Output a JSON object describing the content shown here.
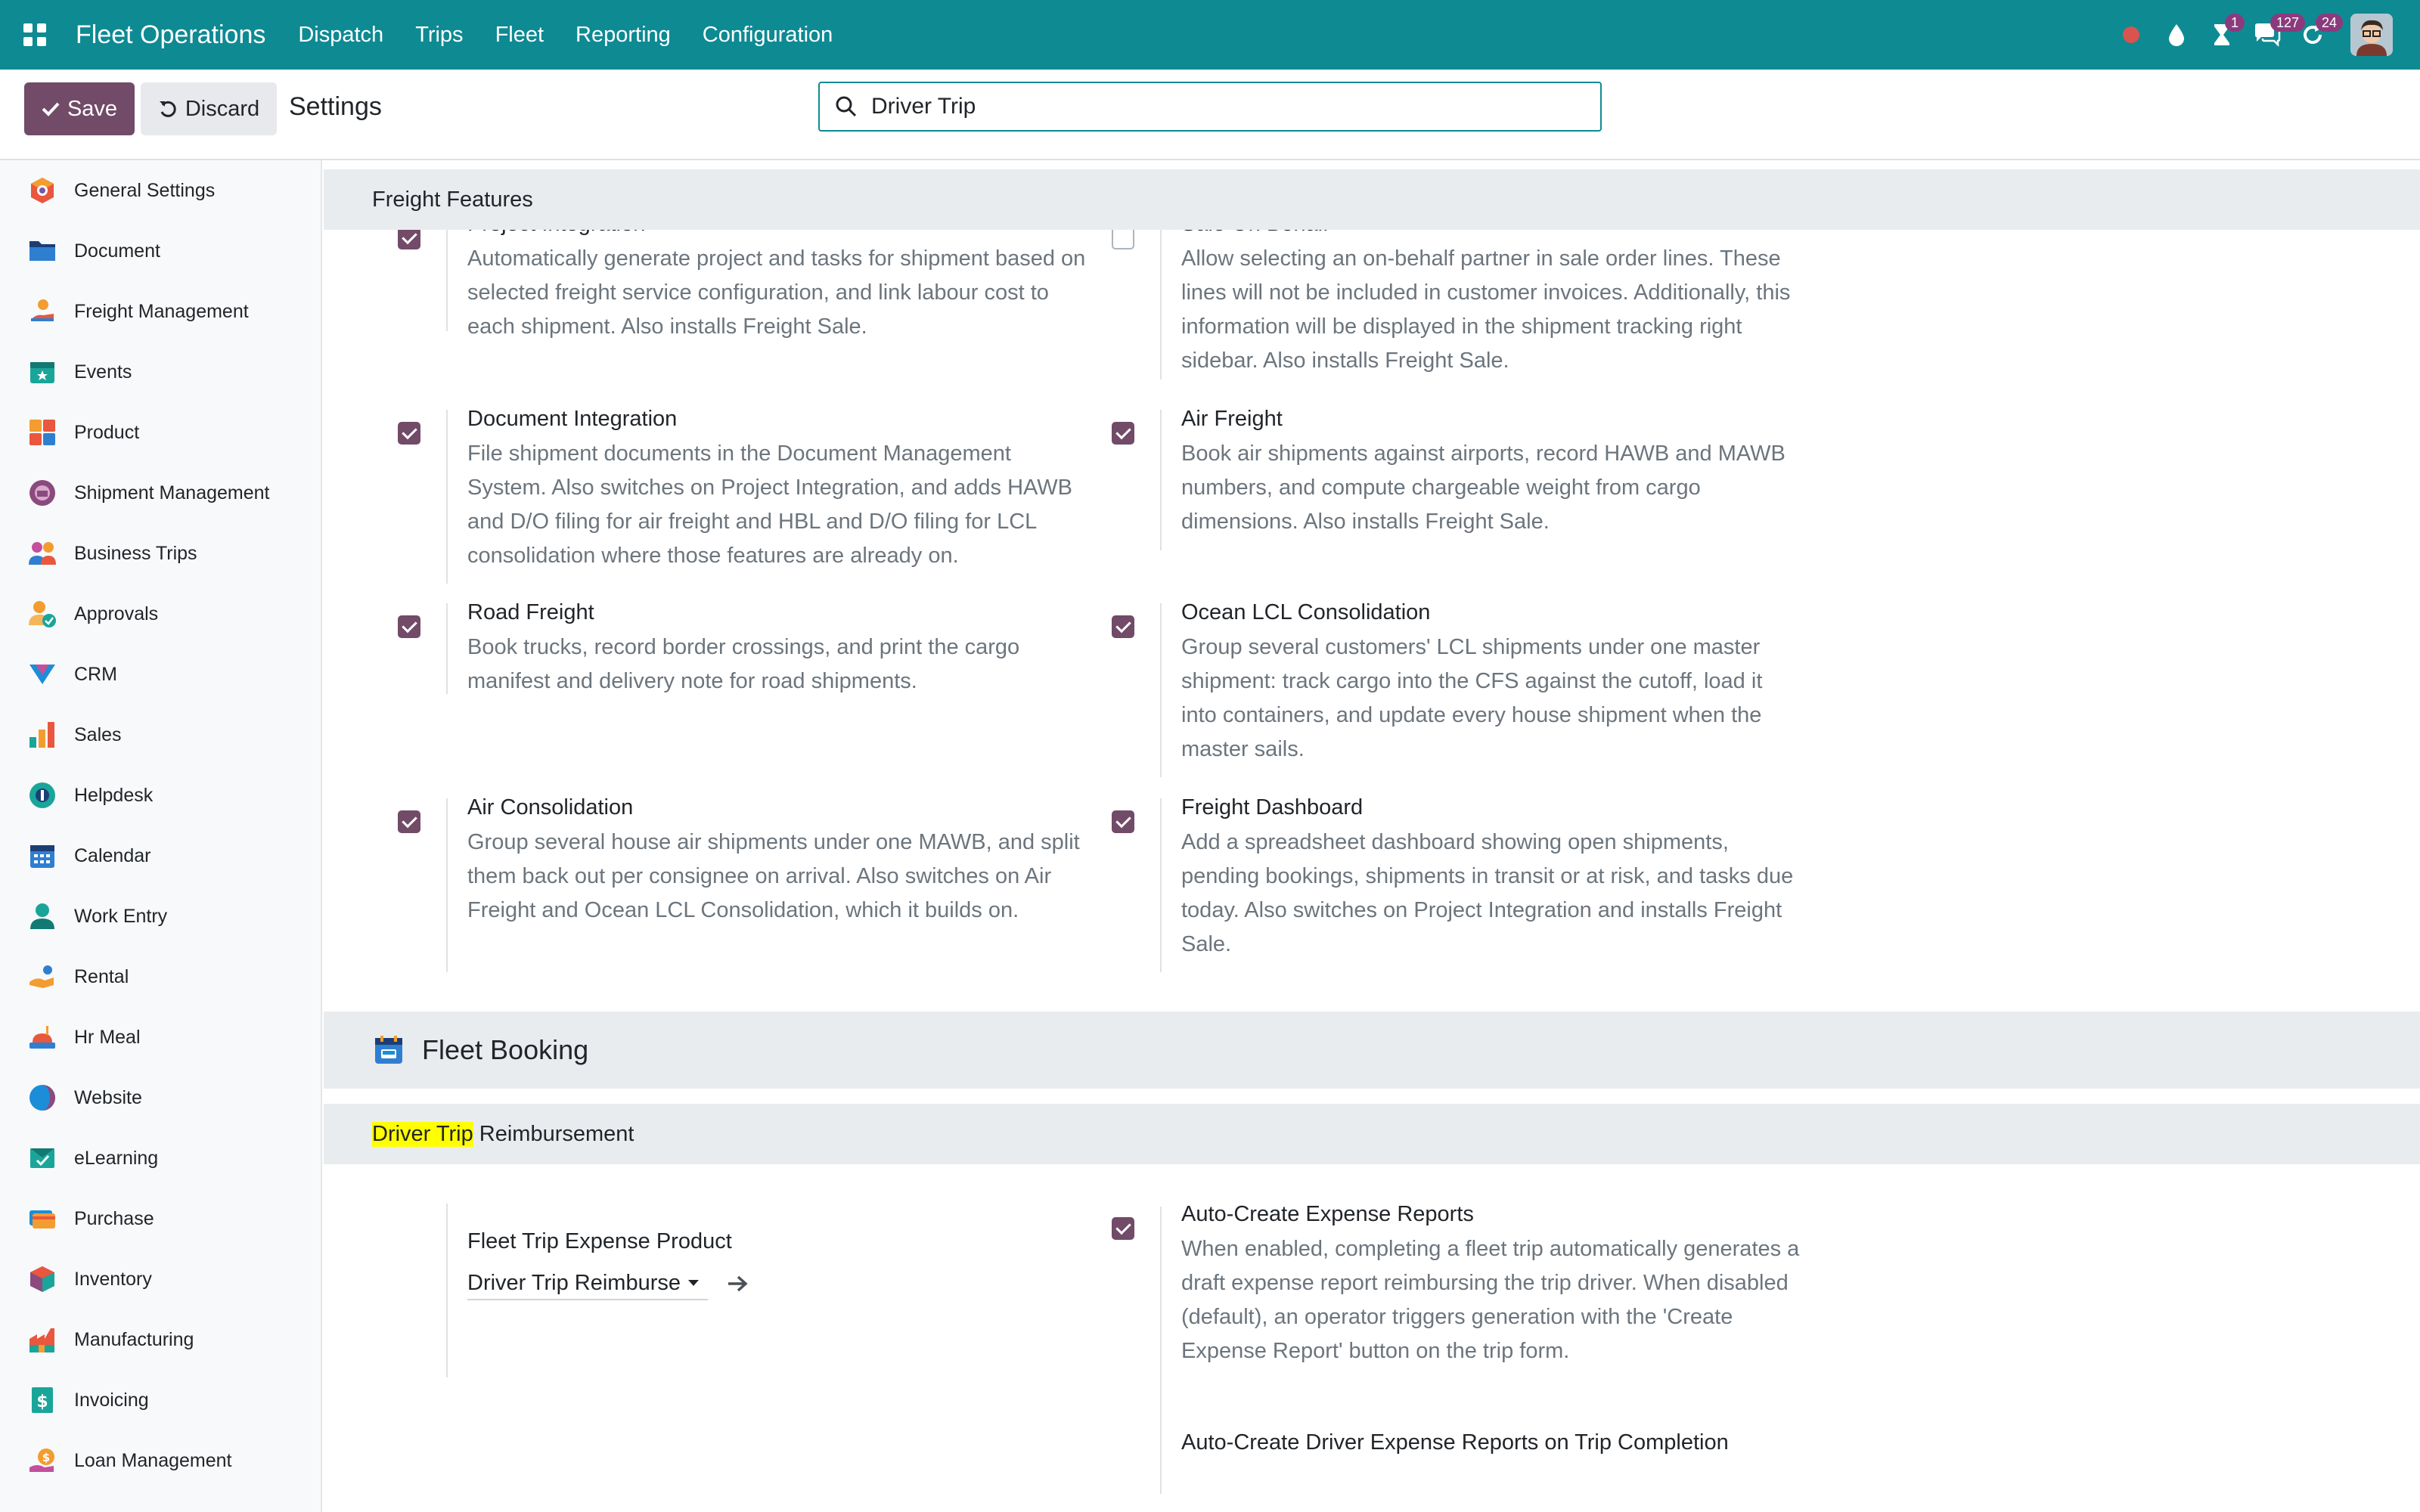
{
  "navbar": {
    "brand": "Fleet Operations",
    "menu": [
      "Dispatch",
      "Trips",
      "Fleet",
      "Reporting",
      "Configuration"
    ],
    "badges": {
      "activities": "1",
      "messages": "127",
      "updates": "24"
    }
  },
  "control": {
    "save_label": "Save",
    "discard_label": "Discard",
    "breadcrumb": "Settings",
    "search_value": "Driver Trip"
  },
  "sidebar": {
    "items": [
      {
        "label": "General Settings",
        "icon": "general-settings-icon"
      },
      {
        "label": "Document",
        "icon": "folder-icon"
      },
      {
        "label": "Freight Management",
        "icon": "freight-icon"
      },
      {
        "label": "Events",
        "icon": "events-icon"
      },
      {
        "label": "Product",
        "icon": "product-icon"
      },
      {
        "label": "Shipment Management",
        "icon": "shipment-icon"
      },
      {
        "label": "Business Trips",
        "icon": "business-trips-icon"
      },
      {
        "label": "Approvals",
        "icon": "approvals-icon"
      },
      {
        "label": "CRM",
        "icon": "crm-icon"
      },
      {
        "label": "Sales",
        "icon": "sales-icon"
      },
      {
        "label": "Helpdesk",
        "icon": "helpdesk-icon"
      },
      {
        "label": "Calendar",
        "icon": "calendar-icon"
      },
      {
        "label": "Work Entry",
        "icon": "work-entry-icon"
      },
      {
        "label": "Rental",
        "icon": "rental-icon"
      },
      {
        "label": "Hr Meal",
        "icon": "hr-meal-icon"
      },
      {
        "label": "Website",
        "icon": "website-icon"
      },
      {
        "label": "eLearning",
        "icon": "elearning-icon"
      },
      {
        "label": "Purchase",
        "icon": "purchase-icon"
      },
      {
        "label": "Inventory",
        "icon": "inventory-icon"
      },
      {
        "label": "Manufacturing",
        "icon": "manufacturing-icon"
      },
      {
        "label": "Invoicing",
        "icon": "invoicing-icon"
      },
      {
        "label": "Loan Management",
        "icon": "loan-icon"
      }
    ]
  },
  "freight": {
    "header": "Freight Features",
    "settings": [
      {
        "title": "Project Integration",
        "checked": true,
        "desc": "Automatically generate project and tasks for shipment based on selected freight service configuration, and link labour cost to each shipment. Also installs Freight Sale."
      },
      {
        "title": "Sale On Behalf",
        "checked": false,
        "desc": "Allow selecting an on-behalf partner in sale order lines. These lines will not be included in customer invoices. Additionally, this information will be displayed in the shipment tracking right sidebar. Also installs Freight Sale."
      },
      {
        "title": "Document Integration",
        "checked": true,
        "desc": "File shipment documents in the Document Management System. Also switches on Project Integration, and adds HAWB and D/O filing for air freight and HBL and D/O filing for LCL consolidation where those features are already on."
      },
      {
        "title": "Air Freight",
        "checked": true,
        "desc": "Book air shipments against airports, record HAWB and MAWB numbers, and compute chargeable weight from cargo dimensions. Also installs Freight Sale."
      },
      {
        "title": "Road Freight",
        "checked": true,
        "desc": "Book trucks, record border crossings, and print the cargo manifest and delivery note for road shipments."
      },
      {
        "title": "Ocean LCL Consolidation",
        "checked": true,
        "desc": "Group several customers' LCL shipments under one master shipment: track cargo into the CFS against the cutoff, load it into containers, and update every house shipment when the master sails."
      },
      {
        "title": "Air Consolidation",
        "checked": true,
        "desc": "Group several house air shipments under one MAWB, and split them back out per consignee on arrival. Also switches on Air Freight and Ocean LCL Consolidation, which it builds on."
      },
      {
        "title": "Freight Dashboard",
        "checked": true,
        "desc": "Add a spreadsheet dashboard showing open shipments, pending bookings, shipments in transit or at risk, and tasks due today. Also switches on Project Integration and installs Freight Sale."
      }
    ]
  },
  "fleet": {
    "app_title": "Fleet Booking",
    "section_highlight": "Driver Trip",
    "section_rest": " Reimbursement",
    "expense_product": {
      "label": "Fleet Trip Expense Product",
      "value": "Driver Trip Reimburse"
    },
    "auto_create": {
      "title": "Auto-Create Expense Reports",
      "checked": true,
      "desc": "When enabled, completing a fleet trip automatically generates a draft expense report reimbursing the trip driver. When disabled (default), an operator triggers generation with the 'Create Expense Report' button on the trip form."
    },
    "next_title": "Auto-Create Driver Expense Reports on Trip Completion"
  }
}
